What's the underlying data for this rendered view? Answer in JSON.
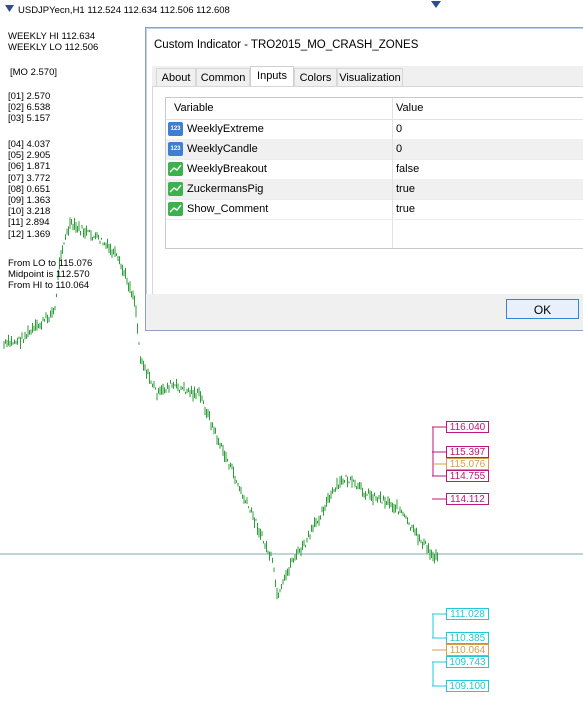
{
  "ticker": {
    "label": "USDJPYecn,H1  112.524 112.634 112.506 112.608"
  },
  "stats": {
    "weekly": [
      "WEEKLY HI 112.634",
      "WEEKLY LO 112.506"
    ],
    "mo": "[MO 2.570]",
    "group1": [
      "[01] 2.570",
      "[02] 6.538",
      "[03] 5.157"
    ],
    "group2": [
      "[04] 4.037",
      "[05] 2.905",
      "[06] 1.871",
      "[07] 3.772",
      "[08] 0.651",
      "[09] 1.363",
      "[10] 3.218",
      "[11] 2.894",
      "[12] 1.369"
    ],
    "summary": [
      "From LO to 115.076",
      "Midpoint is 112.570",
      "From HI to 110.064"
    ]
  },
  "price_tags": {
    "upper": [
      {
        "label": "116.040",
        "color": "#C0157A"
      },
      {
        "label": "115.397",
        "color": "#C0157A"
      },
      {
        "label": "115.076",
        "color": "#D4A04A"
      },
      {
        "label": "114.755",
        "color": "#C0157A"
      },
      {
        "label": "114.112",
        "color": "#C0157A"
      }
    ],
    "lower": [
      {
        "label": "111.028",
        "color": "#22C8D8"
      },
      {
        "label": "110.385",
        "color": "#22C8D8"
      },
      {
        "label": "110.064",
        "color": "#D4A04A"
      },
      {
        "label": "109.743",
        "color": "#22C8D8"
      },
      {
        "label": "109.100",
        "color": "#22C8D8"
      }
    ]
  },
  "dialog": {
    "title": "Custom Indicator - TRO2015_MO_CRASH_ZONES",
    "tabs": [
      "About",
      "Common",
      "Inputs",
      "Colors",
      "Visualization"
    ],
    "active_tab": "Inputs",
    "columns": {
      "variable": "Variable",
      "value": "Value"
    },
    "rows": [
      {
        "name": "WeeklyExtreme",
        "value": "0",
        "icon": "number-icon"
      },
      {
        "name": "WeeklyCandle",
        "value": "0",
        "icon": "number-icon"
      },
      {
        "name": "WeeklyBreakout",
        "value": "false",
        "icon": "boolean-icon"
      },
      {
        "name": "ZuckermansPig",
        "value": "true",
        "icon": "boolean-icon"
      },
      {
        "name": "Show_Comment",
        "value": "true",
        "icon": "boolean-icon"
      }
    ],
    "number_icon_text": "123",
    "ok_label": "OK"
  },
  "colors": {
    "candles": "#2E9E3A",
    "hline": "#7FA8A8",
    "upper_zone": "#C0157A",
    "lower_zone": "#22C8D8",
    "midline": "#D4A04A"
  }
}
